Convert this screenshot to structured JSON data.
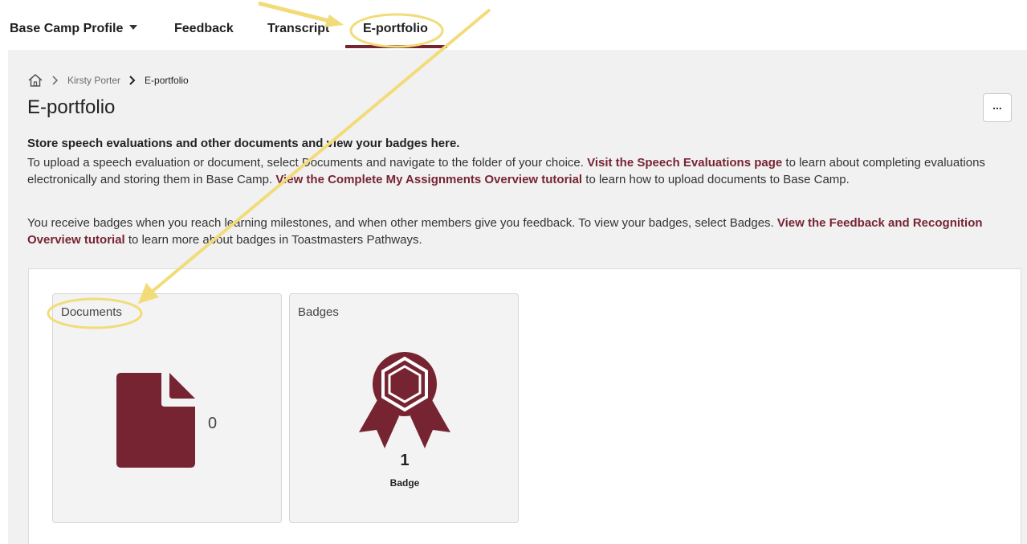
{
  "nav": {
    "profile": "Base Camp Profile",
    "feedback": "Feedback",
    "transcript": "Transcript",
    "eportfolio": "E-portfolio"
  },
  "breadcrumb": {
    "member": "Kirsty Porter",
    "current": "E-portfolio"
  },
  "page": {
    "title": "E-portfolio",
    "more_label": "...",
    "subheading": "Store speech evaluations and other documents and view your badges here.",
    "para1": {
      "t1": "To upload a speech evaluation or document, select Documents and navigate to the folder of your choice. ",
      "link1": "Visit the Speech Evaluations page",
      "t2": " to learn about completing evaluations electronically and storing them in Base Camp. ",
      "link2": "View the Complete My Assignments Overview tutorial",
      "t3": " to learn how to upload documents to Base Camp."
    },
    "para2": {
      "t1": "You receive badges when you reach learning milestones, and when other members give you feedback. To view your badges, select Badges. ",
      "link1": "View the Feedback and Recognition Overview tutorial",
      "t2": " to learn more about badges in Toastmasters Pathways."
    }
  },
  "cards": {
    "documents": {
      "title": "Documents",
      "count": "0",
      "icon": "document-icon"
    },
    "badges": {
      "title": "Badges",
      "count": "1",
      "label": "Badge",
      "icon": "badge-ribbon-icon"
    }
  },
  "colors": {
    "brand": "#772432",
    "annotation": "#f2dc7a"
  }
}
